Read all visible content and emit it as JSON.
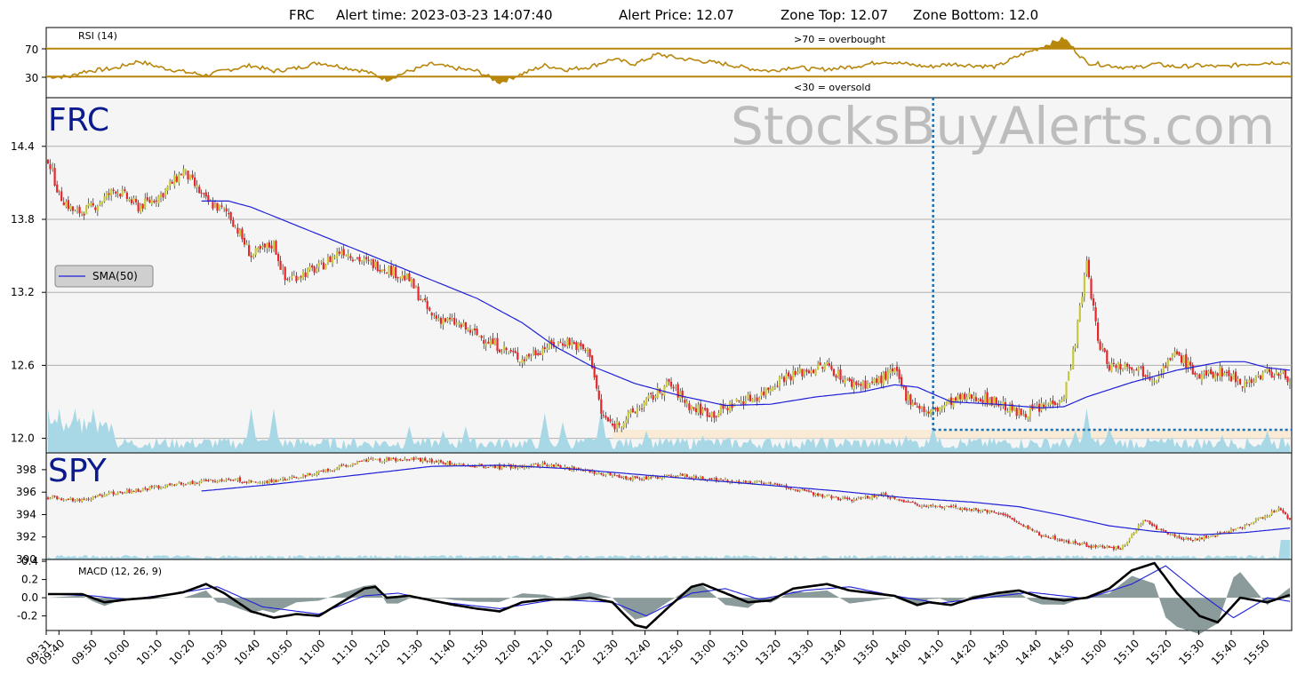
{
  "header": {
    "ticker": "FRC",
    "alert_time": "Alert time: 2023-03-23 14:07:40",
    "alert_price": "Alert Price: 12.07",
    "zone_top": "Zone Top: 12.07",
    "zone_bottom": "Zone Bottom: 12.0"
  },
  "watermark": "StocksBuyAlerts.com",
  "colors": {
    "up": "#c8c83c",
    "down": "#e8262a",
    "sma": "#1f1fd8",
    "volume": "#a8d8e6",
    "rsi": "#b8860b",
    "macd": "#000000",
    "signal": "#1f1fd8",
    "hist": "#5a7070",
    "alert_line": "#1f6fb0",
    "zone": "#faebd7",
    "panel_bg": "#f5f5f5"
  },
  "chart_data": [
    {
      "type": "line",
      "name": "RSI panel",
      "title": "RSI (14)",
      "ylim": [
        0,
        100
      ],
      "yticks": [
        "70",
        "30"
      ],
      "levels": [
        70,
        30
      ],
      "annotations": [
        ">70 = overbought",
        "<30 = oversold"
      ],
      "rsi_keypoints": [
        [
          0,
          30
        ],
        [
          10,
          30
        ],
        [
          15,
          37
        ],
        [
          30,
          42
        ],
        [
          40,
          52
        ],
        [
          50,
          43
        ],
        [
          60,
          37
        ],
        [
          70,
          32
        ],
        [
          80,
          40
        ],
        [
          90,
          46
        ],
        [
          100,
          38
        ],
        [
          110,
          42
        ],
        [
          120,
          50
        ],
        [
          130,
          44
        ],
        [
          140,
          38
        ],
        [
          150,
          26
        ],
        [
          160,
          38
        ],
        [
          170,
          48
        ],
        [
          180,
          42
        ],
        [
          190,
          38
        ],
        [
          200,
          22
        ],
        [
          210,
          34
        ],
        [
          220,
          46
        ],
        [
          230,
          40
        ],
        [
          240,
          44
        ],
        [
          250,
          55
        ],
        [
          260,
          48
        ],
        [
          270,
          62
        ],
        [
          280,
          56
        ],
        [
          290,
          52
        ],
        [
          300,
          48
        ],
        [
          310,
          42
        ],
        [
          320,
          38
        ],
        [
          330,
          44
        ],
        [
          340,
          40
        ],
        [
          350,
          42
        ],
        [
          360,
          46
        ],
        [
          370,
          52
        ],
        [
          380,
          48
        ],
        [
          390,
          44
        ],
        [
          400,
          48
        ],
        [
          410,
          46
        ],
        [
          420,
          44
        ],
        [
          430,
          60
        ],
        [
          440,
          72
        ],
        [
          450,
          84
        ],
        [
          460,
          50
        ],
        [
          470,
          46
        ],
        [
          480,
          42
        ],
        [
          490,
          48
        ],
        [
          500,
          44
        ],
        [
          510,
          46
        ],
        [
          520,
          44
        ],
        [
          530,
          48
        ],
        [
          540,
          50
        ]
      ]
    },
    {
      "type": "candlestick",
      "name": "FRC",
      "label": "FRC",
      "legend": "SMA(50)",
      "legend_position": "mid-left",
      "y_tick_labels": [
        "14.4",
        "13.8",
        "13.2",
        "12.6",
        "12.0"
      ],
      "ylim": [
        11.88,
        14.8
      ],
      "alert_time_index": 392,
      "alert_price": 12.07,
      "zone": [
        12.0,
        12.07
      ],
      "close_keypoints": [
        [
          0,
          14.3
        ],
        [
          5,
          14.0
        ],
        [
          12,
          13.85
        ],
        [
          20,
          13.9
        ],
        [
          30,
          14.05
        ],
        [
          40,
          13.9
        ],
        [
          50,
          14.0
        ],
        [
          60,
          14.2
        ],
        [
          70,
          13.95
        ],
        [
          80,
          13.85
        ],
        [
          90,
          13.5
        ],
        [
          100,
          13.6
        ],
        [
          105,
          13.3
        ],
        [
          112,
          13.35
        ],
        [
          120,
          13.4
        ],
        [
          130,
          13.55
        ],
        [
          140,
          13.45
        ],
        [
          150,
          13.4
        ],
        [
          160,
          13.3
        ],
        [
          170,
          13.0
        ],
        [
          180,
          12.95
        ],
        [
          190,
          12.85
        ],
        [
          200,
          12.75
        ],
        [
          210,
          12.65
        ],
        [
          220,
          12.75
        ],
        [
          230,
          12.8
        ],
        [
          240,
          12.7
        ],
        [
          245,
          12.2
        ],
        [
          250,
          12.1
        ],
        [
          255,
          12.15
        ],
        [
          265,
          12.3
        ],
        [
          275,
          12.45
        ],
        [
          285,
          12.25
        ],
        [
          295,
          12.2
        ],
        [
          305,
          12.3
        ],
        [
          315,
          12.35
        ],
        [
          325,
          12.5
        ],
        [
          335,
          12.55
        ],
        [
          345,
          12.6
        ],
        [
          355,
          12.45
        ],
        [
          365,
          12.45
        ],
        [
          375,
          12.55
        ],
        [
          380,
          12.35
        ],
        [
          390,
          12.2
        ],
        [
          400,
          12.3
        ],
        [
          410,
          12.35
        ],
        [
          420,
          12.3
        ],
        [
          430,
          12.2
        ],
        [
          440,
          12.25
        ],
        [
          450,
          12.35
        ],
        [
          455,
          12.8
        ],
        [
          460,
          13.45
        ],
        [
          465,
          12.8
        ],
        [
          470,
          12.6
        ],
        [
          480,
          12.6
        ],
        [
          490,
          12.5
        ],
        [
          500,
          12.7
        ],
        [
          510,
          12.5
        ],
        [
          520,
          12.55
        ],
        [
          530,
          12.45
        ],
        [
          540,
          12.55
        ],
        [
          550,
          12.5
        ]
      ],
      "sma_keypoints": [
        [
          68,
          13.95
        ],
        [
          80,
          13.95
        ],
        [
          90,
          13.9
        ],
        [
          110,
          13.75
        ],
        [
          130,
          13.6
        ],
        [
          150,
          13.45
        ],
        [
          170,
          13.3
        ],
        [
          190,
          13.15
        ],
        [
          210,
          12.95
        ],
        [
          225,
          12.75
        ],
        [
          240,
          12.6
        ],
        [
          260,
          12.45
        ],
        [
          280,
          12.35
        ],
        [
          300,
          12.27
        ],
        [
          320,
          12.28
        ],
        [
          340,
          12.34
        ],
        [
          360,
          12.38
        ],
        [
          375,
          12.44
        ],
        [
          385,
          12.42
        ],
        [
          400,
          12.3
        ],
        [
          420,
          12.28
        ],
        [
          440,
          12.25
        ],
        [
          450,
          12.26
        ],
        [
          460,
          12.34
        ],
        [
          480,
          12.46
        ],
        [
          500,
          12.56
        ],
        [
          520,
          12.63
        ],
        [
          530,
          12.63
        ],
        [
          540,
          12.58
        ],
        [
          550,
          12.56
        ]
      ]
    },
    {
      "type": "candlestick",
      "name": "SPY",
      "label": "SPY",
      "y_tick_labels": [
        "398",
        "396",
        "394",
        "392",
        "390"
      ],
      "ylim": [
        390,
        399.5
      ],
      "close_keypoints": [
        [
          0,
          395.5
        ],
        [
          15,
          395.3
        ],
        [
          25,
          395.8
        ],
        [
          40,
          396.2
        ],
        [
          60,
          396.8
        ],
        [
          80,
          397.2
        ],
        [
          95,
          396.8
        ],
        [
          110,
          397.3
        ],
        [
          125,
          398.0
        ],
        [
          140,
          398.8
        ],
        [
          160,
          399.0
        ],
        [
          180,
          398.5
        ],
        [
          200,
          398.2
        ],
        [
          220,
          398.5
        ],
        [
          240,
          397.8
        ],
        [
          260,
          397.2
        ],
        [
          280,
          397.5
        ],
        [
          300,
          397.0
        ],
        [
          320,
          396.8
        ],
        [
          340,
          395.8
        ],
        [
          355,
          395.3
        ],
        [
          370,
          395.8
        ],
        [
          380,
          395.0
        ],
        [
          400,
          394.7
        ],
        [
          420,
          394.2
        ],
        [
          440,
          392.2
        ],
        [
          460,
          391.2
        ],
        [
          475,
          391.0
        ],
        [
          485,
          393.5
        ],
        [
          495,
          392.3
        ],
        [
          505,
          391.8
        ],
        [
          515,
          392.0
        ],
        [
          530,
          393.0
        ],
        [
          545,
          394.5
        ],
        [
          550,
          393.5
        ]
      ],
      "sma_keypoints": [
        [
          68,
          396.1
        ],
        [
          100,
          396.7
        ],
        [
          140,
          397.6
        ],
        [
          170,
          398.3
        ],
        [
          200,
          398.4
        ],
        [
          230,
          398.1
        ],
        [
          260,
          397.6
        ],
        [
          290,
          397.1
        ],
        [
          320,
          396.6
        ],
        [
          350,
          396.1
        ],
        [
          380,
          395.5
        ],
        [
          410,
          395.1
        ],
        [
          430,
          394.7
        ],
        [
          450,
          393.9
        ],
        [
          470,
          393.0
        ],
        [
          490,
          392.5
        ],
        [
          510,
          392.2
        ],
        [
          530,
          392.4
        ],
        [
          550,
          392.8
        ]
      ]
    },
    {
      "type": "line",
      "name": "MACD panel",
      "title": "MACD (12, 26, 9)",
      "y_tick_labels": [
        "0.4",
        "0.2",
        "0.0",
        "-0.2"
      ],
      "ylim": [
        -0.36,
        0.42
      ],
      "macd_keypoints": [
        [
          0,
          0.04
        ],
        [
          15,
          0.04
        ],
        [
          25,
          -0.05
        ],
        [
          35,
          -0.02
        ],
        [
          45,
          0.0
        ],
        [
          60,
          0.06
        ],
        [
          70,
          0.15
        ],
        [
          78,
          0.05
        ],
        [
          90,
          -0.15
        ],
        [
          100,
          -0.22
        ],
        [
          110,
          -0.18
        ],
        [
          120,
          -0.2
        ],
        [
          130,
          -0.05
        ],
        [
          140,
          0.1
        ],
        [
          145,
          0.12
        ],
        [
          150,
          0.0
        ],
        [
          160,
          0.02
        ],
        [
          170,
          -0.03
        ],
        [
          180,
          -0.08
        ],
        [
          190,
          -0.12
        ],
        [
          200,
          -0.15
        ],
        [
          210,
          -0.05
        ],
        [
          220,
          -0.02
        ],
        [
          230,
          -0.02
        ],
        [
          240,
          0.0
        ],
        [
          250,
          -0.05
        ],
        [
          255,
          -0.18
        ],
        [
          260,
          -0.3
        ],
        [
          265,
          -0.33
        ],
        [
          275,
          -0.1
        ],
        [
          285,
          0.12
        ],
        [
          290,
          0.15
        ],
        [
          300,
          0.05
        ],
        [
          310,
          -0.05
        ],
        [
          320,
          -0.03
        ],
        [
          330,
          0.1
        ],
        [
          345,
          0.15
        ],
        [
          355,
          0.08
        ],
        [
          365,
          0.05
        ],
        [
          375,
          0.02
        ],
        [
          385,
          -0.08
        ],
        [
          390,
          -0.05
        ],
        [
          400,
          -0.08
        ],
        [
          410,
          0.0
        ],
        [
          420,
          0.05
        ],
        [
          430,
          0.08
        ],
        [
          440,
          0.0
        ],
        [
          450,
          -0.03
        ],
        [
          460,
          0.0
        ],
        [
          470,
          0.1
        ],
        [
          480,
          0.3
        ],
        [
          490,
          0.38
        ],
        [
          500,
          0.05
        ],
        [
          510,
          -0.2
        ],
        [
          518,
          -0.27
        ],
        [
          528,
          0.0
        ],
        [
          540,
          -0.05
        ],
        [
          550,
          0.03
        ]
      ],
      "signal_keypoints": [
        [
          0,
          0.04
        ],
        [
          20,
          0.02
        ],
        [
          35,
          -0.02
        ],
        [
          55,
          0.04
        ],
        [
          75,
          0.12
        ],
        [
          95,
          -0.1
        ],
        [
          120,
          -0.18
        ],
        [
          140,
          0.02
        ],
        [
          155,
          0.05
        ],
        [
          175,
          -0.05
        ],
        [
          200,
          -0.12
        ],
        [
          225,
          -0.02
        ],
        [
          250,
          -0.05
        ],
        [
          265,
          -0.2
        ],
        [
          285,
          0.05
        ],
        [
          300,
          0.1
        ],
        [
          315,
          -0.02
        ],
        [
          335,
          0.08
        ],
        [
          355,
          0.12
        ],
        [
          375,
          0.02
        ],
        [
          395,
          -0.06
        ],
        [
          415,
          0.0
        ],
        [
          435,
          0.06
        ],
        [
          460,
          -0.01
        ],
        [
          480,
          0.15
        ],
        [
          495,
          0.35
        ],
        [
          510,
          0.05
        ],
        [
          525,
          -0.22
        ],
        [
          540,
          0.0
        ],
        [
          550,
          -0.04
        ]
      ]
    }
  ],
  "x_axis": {
    "labels": [
      "09:31",
      "09:40",
      "09:50",
      "10:00",
      "10:10",
      "10:20",
      "10:30",
      "10:40",
      "10:50",
      "11:00",
      "11:10",
      "11:20",
      "11:30",
      "11:40",
      "11:50",
      "12:00",
      "12:10",
      "12:20",
      "12:30",
      "12:40",
      "12:50",
      "13:00",
      "13:10",
      "13:20",
      "13:30",
      "13:40",
      "13:50",
      "14:00",
      "14:10",
      "14:20",
      "14:30",
      "14:40",
      "14:50",
      "15:00",
      "15:10",
      "15:20",
      "15:30",
      "15:40",
      "15:50"
    ]
  }
}
